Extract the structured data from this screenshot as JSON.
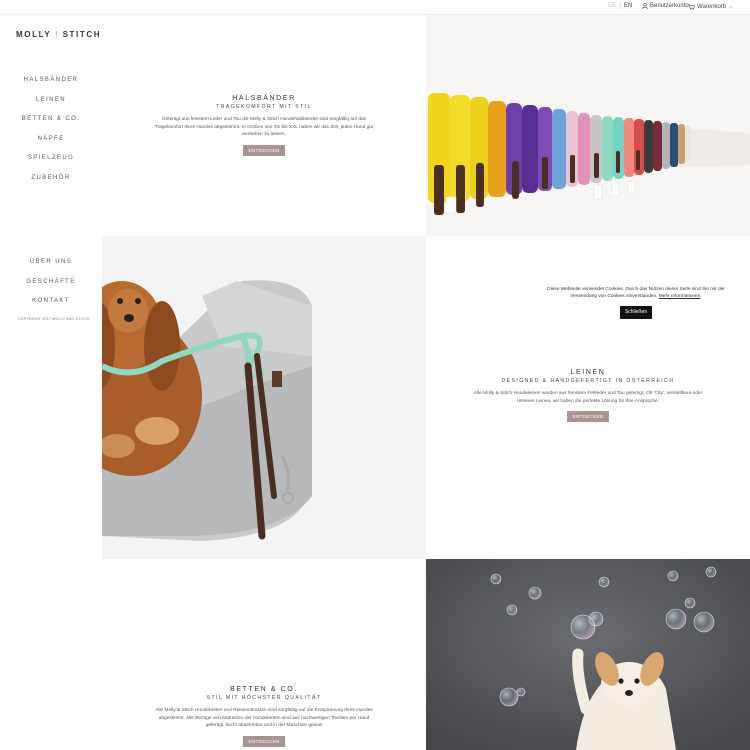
{
  "topbar": {
    "lang_de": "DE",
    "lang_sep": "|",
    "lang_en": "EN",
    "account": "Benutzerkonto",
    "cart": "Warenkorb",
    "cart_caret": "⌄"
  },
  "logo": {
    "part1": "MOLLY",
    "part2": "STITCH"
  },
  "nav_primary": [
    "HALSBÄNDER",
    "LEINEN",
    "BETTEN & CO.",
    "NÄPFE",
    "SPIELZEUG",
    "ZUBEHÖR"
  ],
  "nav_secondary": [
    "ÜBER UNS",
    "GESCHÄFTE",
    "KONTAKT"
  ],
  "copyright": "COPYRIGHT 2017 MOLLY AND STITCH",
  "sections": {
    "collars": {
      "title": "HALSBÄNDER",
      "subtitle": "TRAGEKOMFORT MIT STIL",
      "desc": "Gefertigt aus feinstem Leder und Tau die Molly & Stitch Hundehalsbänder sind sorgfältig auf das Tragekomfort Ihres Hundes abgestimmt. In Größen von XS bis XXL haben wir das Ziel, jeden Hund gut aussehen zu lassen.",
      "button": "ENTDECKEN"
    },
    "leashes": {
      "title": "LEINEN",
      "subtitle": "DESIGNED & HANDGEFERTIGT IN ÖSTERREICH",
      "desc": "Alle Molly & Stitch Hundeleinen werden aus feinstem Fettleder und Tau gefertigt. Ob 'City', verstellbare oder retriever Leinen, wir haben die perfekte Lösung für Ihre Ansprüche.",
      "button": "ENTDECKEN"
    },
    "beds": {
      "title": "BETTEN & CO.",
      "subtitle": "STIL MIT HÖCHSTER QUALITÄT",
      "desc": "Alle Molly & Stitch Hundebetten und Reisematratzen sind sorgfältig auf die Entspannung Ihres Hundes abgestimmt. Alle Bezüge und Matratzen der Hundebetten sind aus hochwertigen Textilien per Hand gefertigt, leicht abnehmbar und in der Maschine gewas",
      "button": "ENTDECKEN"
    }
  },
  "cookie": {
    "text": "Diese Webseite verwendet Cookies. Durch das Nutzen dieser Seite sind Sie mit der Verwendung von Cookies einverstanden.",
    "link": "Mehr Informationen",
    "button": "Schließen"
  },
  "colors": {
    "button_bg": "#a99494",
    "photo_dark_bg": "#545659",
    "mint": "#8fd8c2",
    "leather": "#4a2e22"
  },
  "images": {
    "collars_photo": "colorful-collars-photo",
    "dog_bed_photo": "spaniel-in-dog-bed-photo",
    "bubbles_photo": "dog-with-bubbles-photo"
  }
}
